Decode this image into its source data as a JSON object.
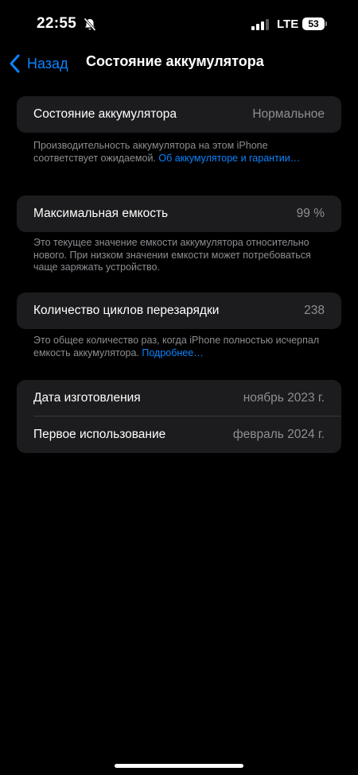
{
  "status_bar": {
    "time": "22:55",
    "network": "LTE",
    "battery_level": "53",
    "icons": [
      "bell-slash-icon",
      "signal-icon",
      "battery-icon"
    ]
  },
  "nav": {
    "back_label": "Назад",
    "title": "Состояние аккумулятора"
  },
  "battery_health": {
    "label": "Состояние аккумулятора",
    "value": "Нормальное",
    "footnote": "Производительность аккумулятора на этом iPhone соответствует ожидаемой. ",
    "footnote_link": "Об аккумуляторе и гарантии…"
  },
  "max_capacity": {
    "label": "Максимальная емкость",
    "value": "99 %",
    "footnote": "Это текущее значение емкости аккумулятора относительно нового. При низком значении емкости может потребоваться чаще заряжать устройство."
  },
  "cycle_count": {
    "label": "Количество циклов перезарядки",
    "value": "238",
    "footnote": "Это общее количество раз, когда iPhone полностью исчерпал емкость аккумулятора. ",
    "footnote_link": "Подробнее…"
  },
  "dates": {
    "manufacture_label": "Дата изготовления",
    "manufacture_value": "ноябрь 2023 г.",
    "first_use_label": "Первое использование",
    "first_use_value": "февраль 2024 г."
  },
  "colors": {
    "background": "#000000",
    "group_background": "#1c1c1e",
    "accent": "#0a84ff",
    "secondary_text": "#8e8e93"
  }
}
